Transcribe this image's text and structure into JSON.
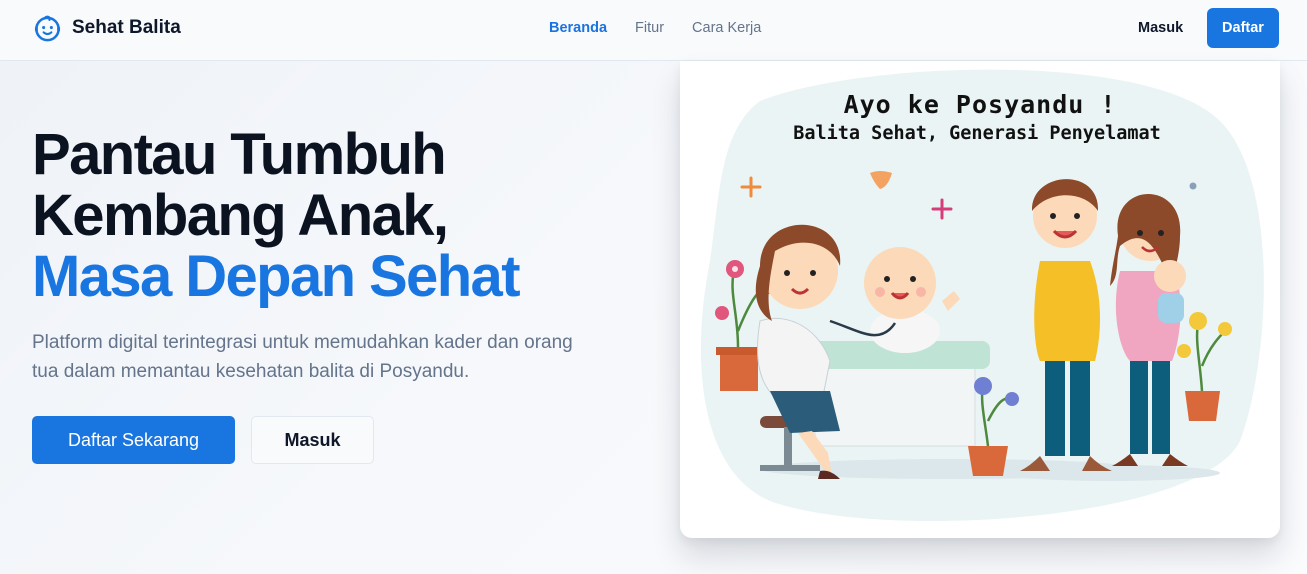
{
  "header": {
    "brand": "Sehat Balita",
    "nav": [
      {
        "label": "Beranda",
        "active": true
      },
      {
        "label": "Fitur",
        "active": false
      },
      {
        "label": "Cara Kerja",
        "active": false
      }
    ],
    "login_label": "Masuk",
    "register_label": "Daftar"
  },
  "hero": {
    "title_line1": "Pantau Tumbuh",
    "title_line2": "Kembang Anak,",
    "title_accent": "Masa Depan Sehat",
    "description": "Platform digital terintegrasi untuk memudahkan kader dan orang tua dalam memantau kesehatan balita di Posyandu.",
    "primary_button": "Daftar Sekarang",
    "secondary_button": "Masuk"
  },
  "illustration": {
    "title": "Ayo ke Posyandu !",
    "subtitle": "Balita Sehat, Generasi Penyelamat"
  },
  "colors": {
    "accent": "#1976e0",
    "heading": "#0b1220",
    "muted": "#64748b"
  }
}
